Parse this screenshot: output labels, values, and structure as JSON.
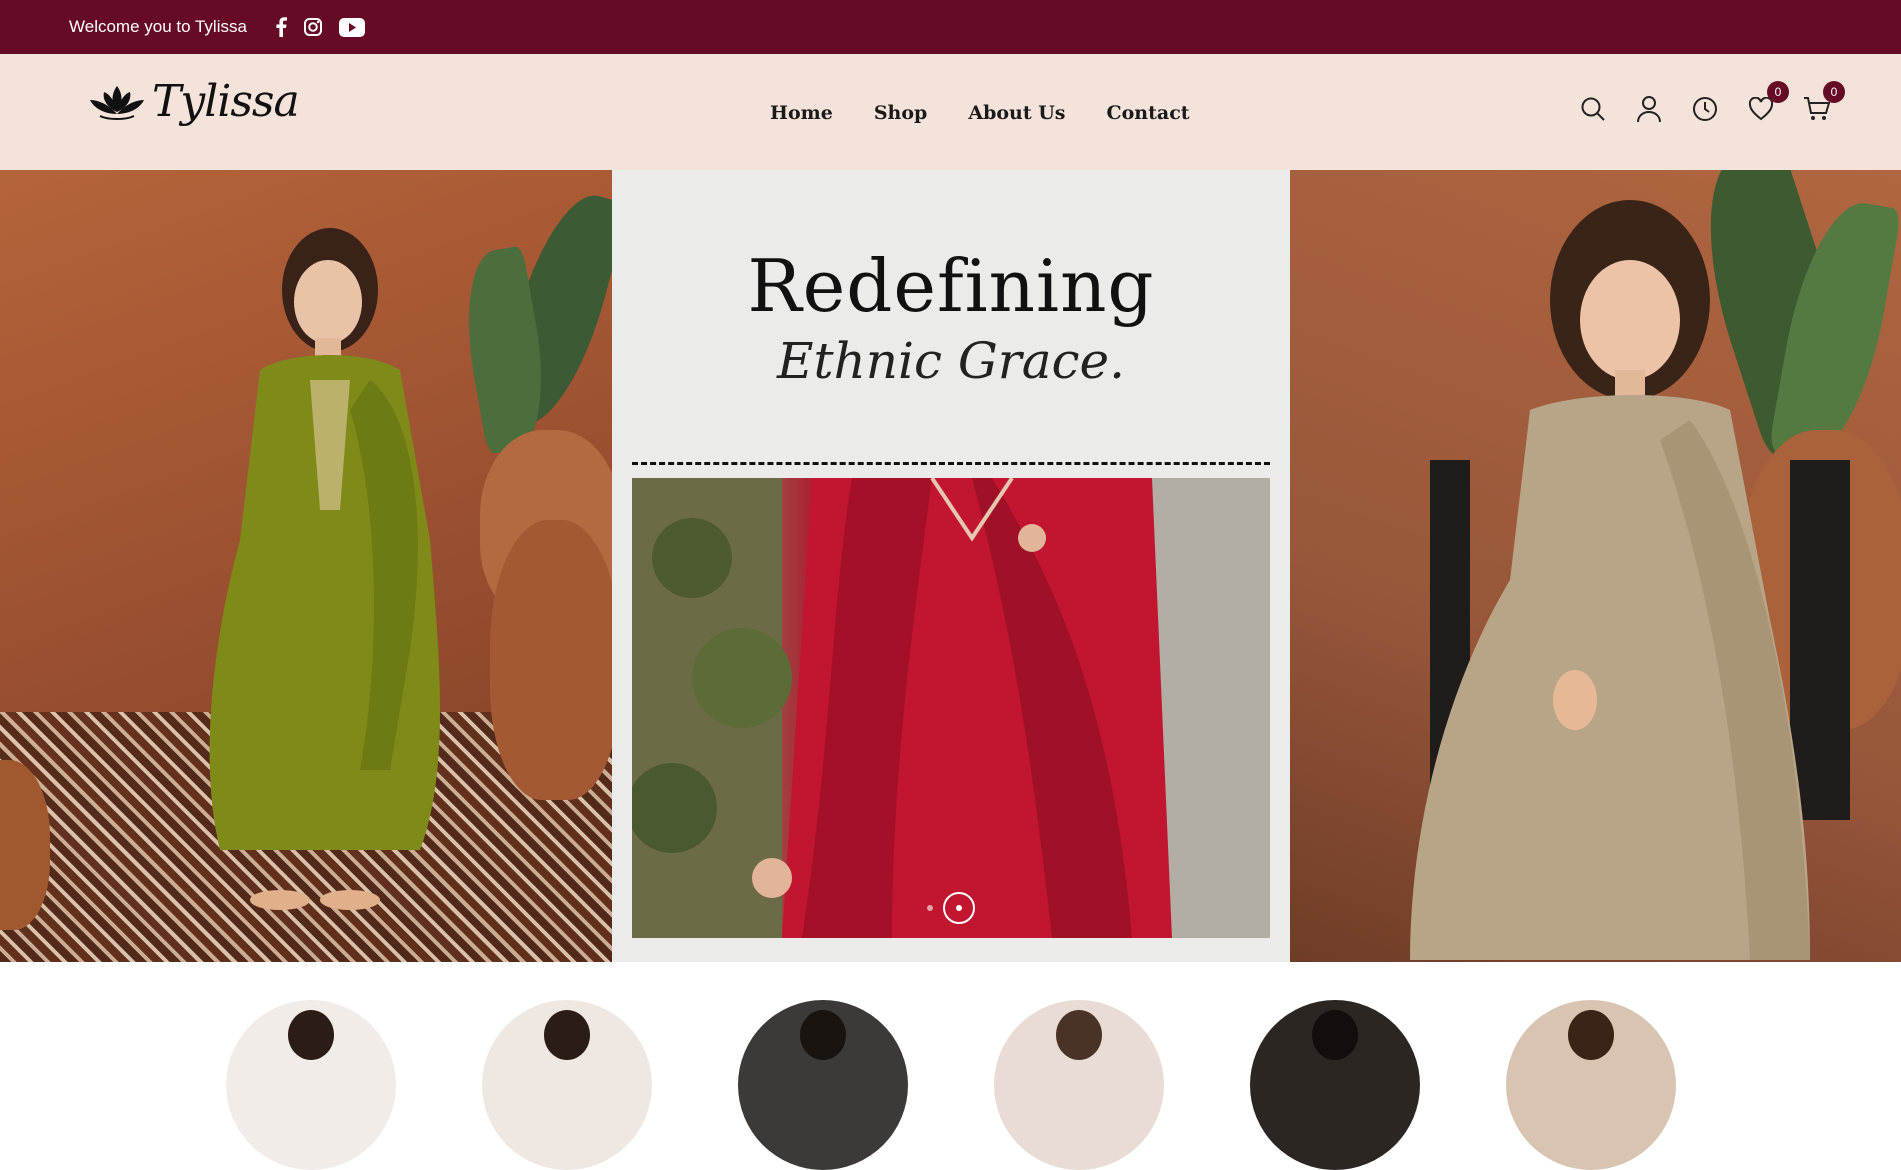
{
  "topbar": {
    "welcome": "Welcome you to Tylissa",
    "social": [
      "facebook-icon",
      "instagram-icon",
      "youtube-icon"
    ]
  },
  "header": {
    "logo_text": "Tylissa",
    "nav": [
      "Home",
      "Shop",
      "About Us",
      "Contact"
    ],
    "wishlist_count": "0",
    "cart_count": "0"
  },
  "hero": {
    "headline": "Redefining",
    "subline": "Ethnic Grace."
  },
  "colors": {
    "brand": "#650b26",
    "header_bg": "#f4e3da"
  }
}
